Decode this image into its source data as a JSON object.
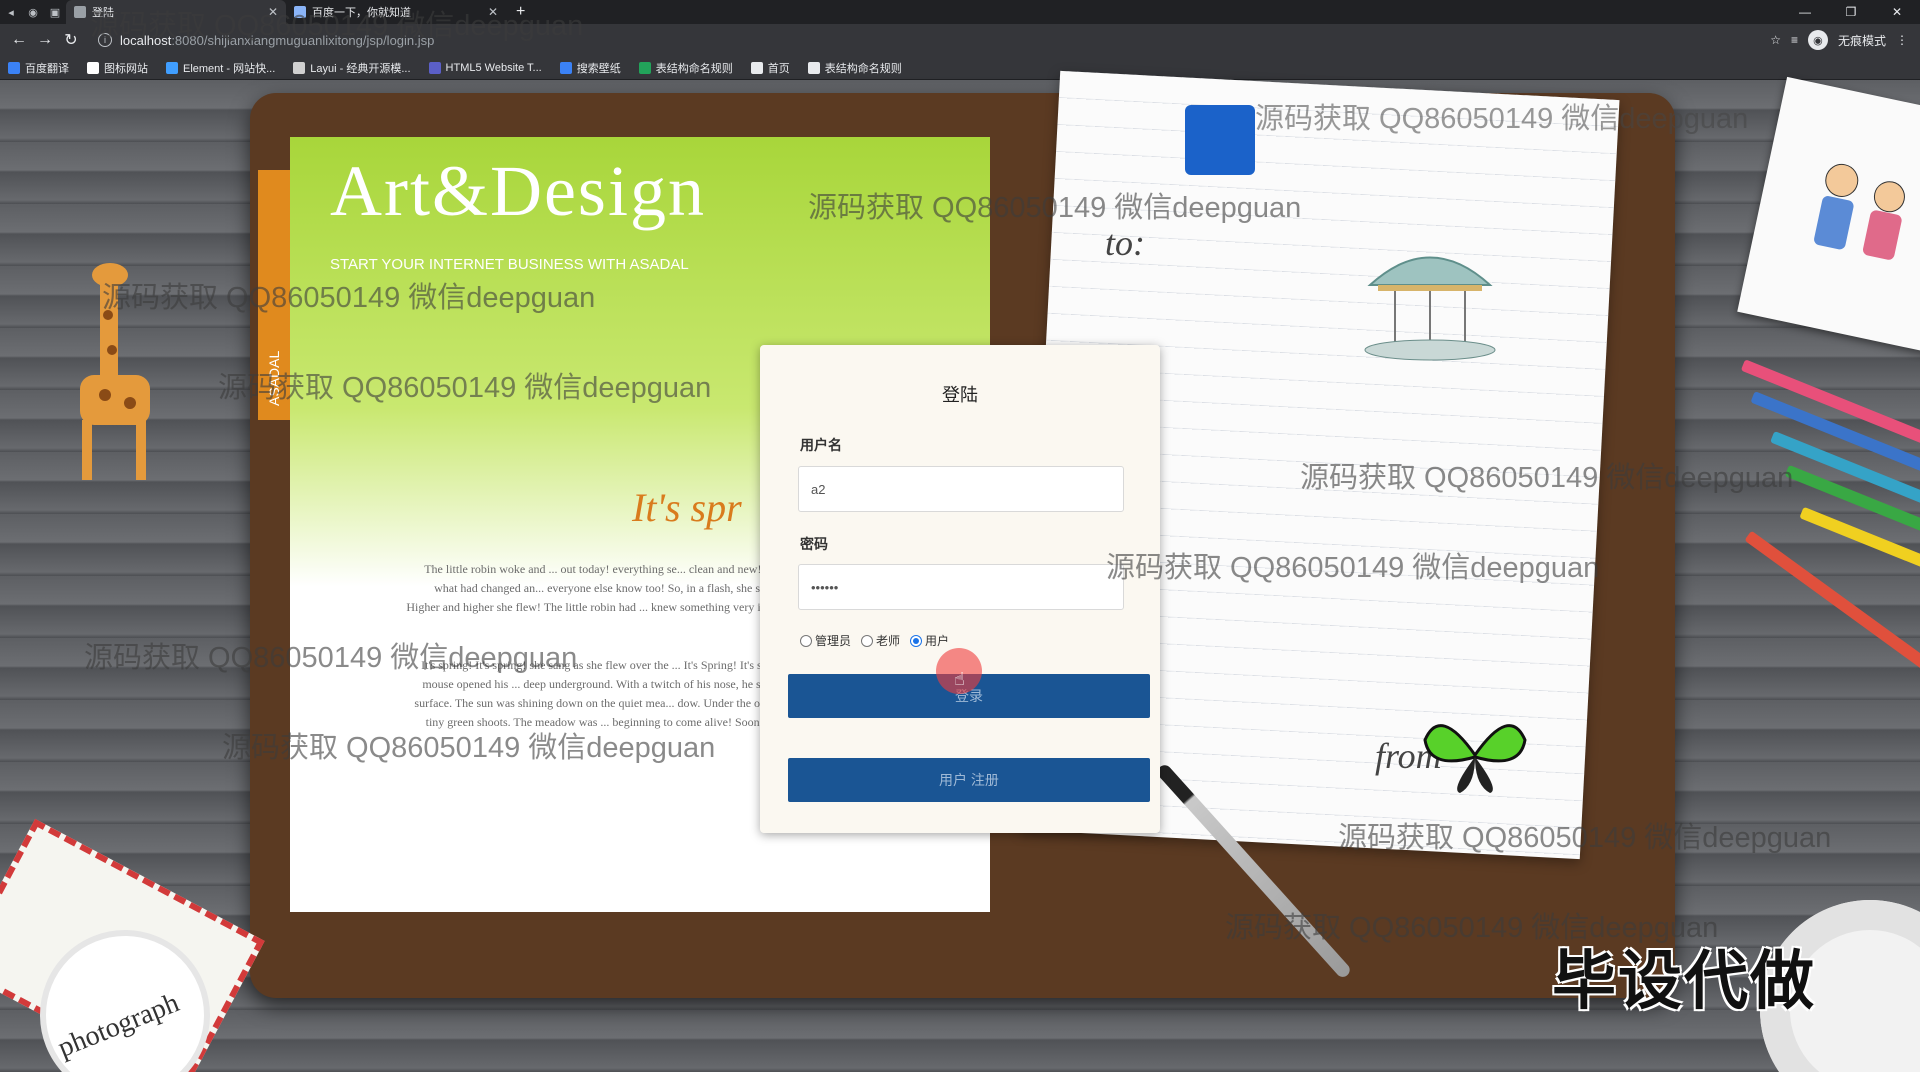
{
  "browser": {
    "tabs": [
      {
        "title": "登陆",
        "active": true
      },
      {
        "title": "百度一下，你就知道",
        "active": false
      }
    ],
    "new_tab": "+",
    "address": {
      "host": "localhost",
      "path": ":8080/shijianxiangmuguanlixitong/jsp/login.jsp"
    },
    "incognito_label": "无痕模式",
    "bookmarks": [
      {
        "label": "百度翻译",
        "color": "#3b82f6"
      },
      {
        "label": "图标网站",
        "color": "#ffffff"
      },
      {
        "label": "Element - 网站快...",
        "color": "#409eff"
      },
      {
        "label": "Layui - 经典开源模...",
        "color": "#d0d0d0"
      },
      {
        "label": "HTML5 Website T...",
        "color": "#5b5fc7"
      },
      {
        "label": "搜索壁纸",
        "color": "#3b82f6"
      },
      {
        "label": "表结构命名规则",
        "color": "#22a35a"
      },
      {
        "label": "首页",
        "color": "#e8eaed"
      },
      {
        "label": "表结构命名规则",
        "color": "#e8eaed"
      }
    ]
  },
  "background": {
    "art_design": "Art&Design",
    "start_line": "START YOUR INTERNET BUSINESS WITH ASADAL",
    "side_tab": "ASADAL",
    "its_spring": "It's spr",
    "body_text_1": "The little robin woke and ... out today! everything se... clean and new! Suddenly, she knew what had changed an... everyone else know too! So, in a flash, she soared into th... went! Higher and higher she flew! The little robin had ... knew something very important, something onl...",
    "body_text_2": "It's spring! It's spring! she sang as she flew over the ... It's Spring! It's spring! A sleepy field mouse opened his ... deep underground. With a twitch of his nose, he s... passageway to the surface. The sun was shining down on the quiet mea... dow. Under the old, brown grass were tiny green shoots. The meadow was ... beginning to come alive! Soon it would be lush and green and beautiful!",
    "to": "to:",
    "from": "from",
    "photograph": "photograph"
  },
  "login": {
    "title": "登陆",
    "username_label": "用户名",
    "username_value": "a2",
    "password_label": "密码",
    "password_value": "••••••",
    "roles": [
      {
        "label": "管理员",
        "checked": false
      },
      {
        "label": "老师",
        "checked": false
      },
      {
        "label": "用户",
        "checked": true
      }
    ],
    "login_button": "登录",
    "register_button": "用户 注册"
  },
  "watermarks": [
    "源码获取 QQ86050149 微信deepguan",
    "源码获取 QQ86050149 微信deepguan",
    "源码获取 QQ86050149 微信deepguan",
    "源码获取 QQ86050149 微信deepguan",
    "源码获取 QQ86050149 微信deepguan",
    "源码获取 QQ86050149 微信deepguan",
    "源码获取 QQ86050149 微信deepguan",
    "源码获取 QQ86050149 微信deepguan",
    "源码获取 QQ86050149 微信deepguan",
    "源码获取 QQ86050149 微信deepguan",
    "源码获取 QQ86050149 微信deepguan"
  ],
  "corner_stamp": "毕设代做"
}
